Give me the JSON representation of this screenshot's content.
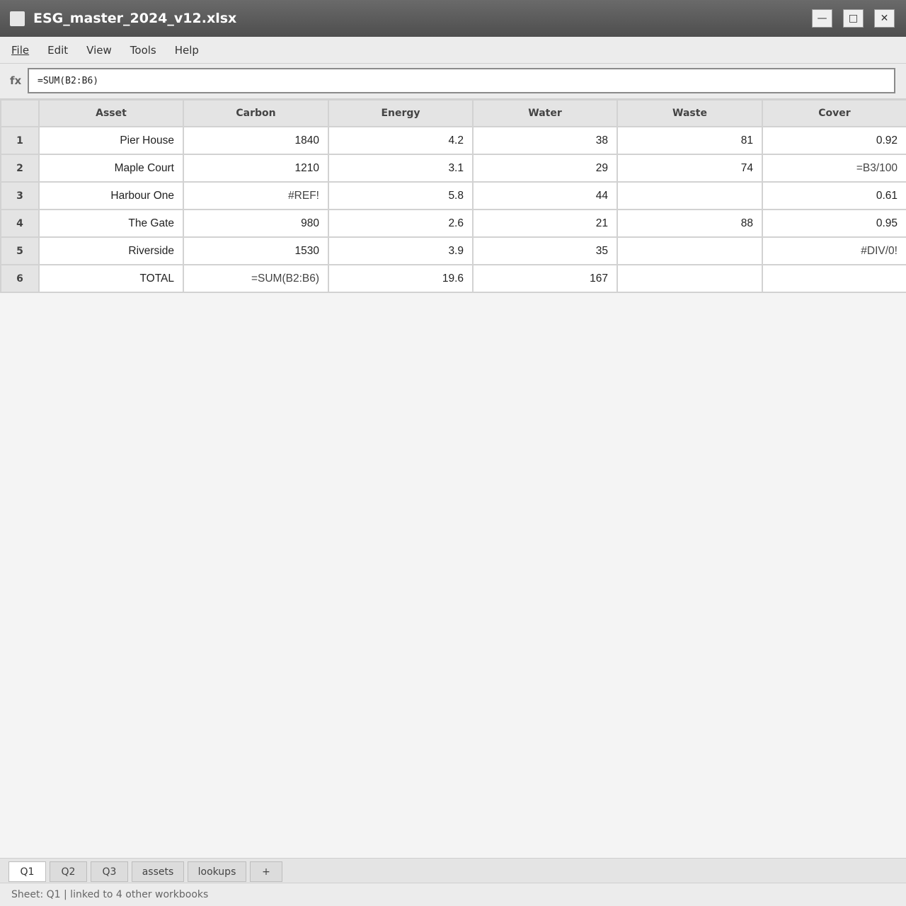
{
  "window": {
    "title": "ESG_master_2024_v12.xlsx",
    "minimize_glyph": "—",
    "maximize_glyph": "□",
    "close_glyph": "✕"
  },
  "menu": [
    "File",
    "Edit",
    "View",
    "Tools",
    "Help"
  ],
  "formula_bar": {
    "label": "fx",
    "value": "=SUM(B2:B6)"
  },
  "grid": {
    "columns": [
      "Asset",
      "Carbon",
      "Energy",
      "Water",
      "Waste",
      "Cover"
    ],
    "rows": [
      {
        "num": "1",
        "cells": [
          "Pier House",
          "1840",
          "4.2",
          "38",
          "81",
          "0.92"
        ]
      },
      {
        "num": "2",
        "cells": [
          "Maple Court",
          "1210",
          "3.1",
          "29",
          "74",
          "=B3/100"
        ]
      },
      {
        "num": "3",
        "cells": [
          "Harbour One",
          "#REF!",
          "5.8",
          "44",
          "",
          "0.61"
        ]
      },
      {
        "num": "4",
        "cells": [
          "The Gate",
          "980",
          "2.6",
          "21",
          "88",
          "0.95"
        ]
      },
      {
        "num": "5",
        "cells": [
          "Riverside",
          "1530",
          "3.9",
          "35",
          "",
          "#DIV/0!"
        ]
      },
      {
        "num": "6",
        "cells": [
          "TOTAL",
          "=SUM(B2:B6)",
          "19.6",
          "167",
          "",
          ""
        ]
      }
    ]
  },
  "sheets": [
    {
      "label": "Q1",
      "active": true
    },
    {
      "label": "Q2",
      "active": false
    },
    {
      "label": "Q3",
      "active": false
    },
    {
      "label": "assets",
      "active": false
    },
    {
      "label": "lookups",
      "active": false
    },
    {
      "label": "+",
      "active": false
    }
  ],
  "status": "Sheet: Q1 | linked to 4 other workbooks"
}
